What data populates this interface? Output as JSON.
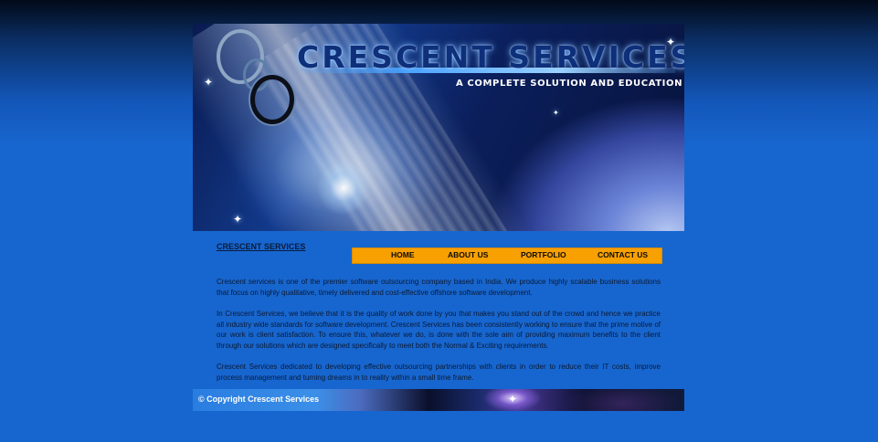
{
  "banner": {
    "title": "CRESCENT SERVICES",
    "tagline": "A COMPLETE SOLUTION AND EDUCATION"
  },
  "page": {
    "heading": "CRESCENT SERVICES"
  },
  "nav": {
    "items": [
      "HOME",
      "ABOUT US",
      "PORTFOLIO",
      "CONTACT US"
    ],
    "color": "#f7a000"
  },
  "content": {
    "paragraphs": [
      "Crescent services is one of the premier software outsourcing company based in India. We produce highly scalable business solutions that focus on highly qualitative, timely delivered and cost-effective offshore software development.",
      "In Crescent Services, we believe that it is the quality of work done by you that makes you stand out of the crowd and hence we practice all industry wide standards for software development. Crescent Services has been consistently working to ensure that the prime motive of our work is client satisfaction. To ensure this, whatever we do, is done with the sole aim of providing maximum benefits to the client through our solutions which are designed specifically to meet both the Normal & Exciting requirements.",
      "Crescent Services dedicated to developing effective outsourcing partnerships with clients in order to reduce their IT costs, improve process management and turning dreams in to reality within a small time frame."
    ]
  },
  "footer": {
    "copyright": "©  Copyright Crescent Services"
  },
  "colors": {
    "background": "#1766cf",
    "text": "#0b1933"
  }
}
